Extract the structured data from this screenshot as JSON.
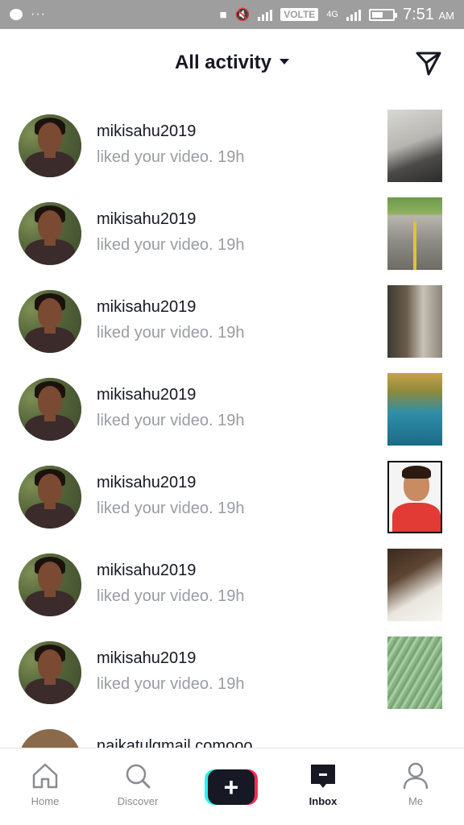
{
  "status_bar": {
    "network_label": "VOLTE",
    "network_type": "4G",
    "time": "7:51",
    "ampm": "AM",
    "battery_level": 0.55
  },
  "header": {
    "title": "All activity",
    "send_icon": "paper-plane-icon"
  },
  "activities": [
    {
      "username": "mikisahu2019",
      "text": "liked your video.",
      "time": "19h"
    },
    {
      "username": "mikisahu2019",
      "text": "liked your video.",
      "time": "19h"
    },
    {
      "username": "mikisahu2019",
      "text": "liked your video.",
      "time": "19h"
    },
    {
      "username": "mikisahu2019",
      "text": "liked your video.",
      "time": "19h"
    },
    {
      "username": "mikisahu2019",
      "text": "liked your video.",
      "time": "19h"
    },
    {
      "username": "mikisahu2019",
      "text": "liked your video.",
      "time": "19h"
    },
    {
      "username": "mikisahu2019",
      "text": "liked your video.",
      "time": "19h"
    }
  ],
  "partial_activity": {
    "username": "naikatulgmail.comooo"
  },
  "nav": {
    "home": "Home",
    "discover": "Discover",
    "inbox": "Inbox",
    "me": "Me",
    "active": "inbox"
  }
}
